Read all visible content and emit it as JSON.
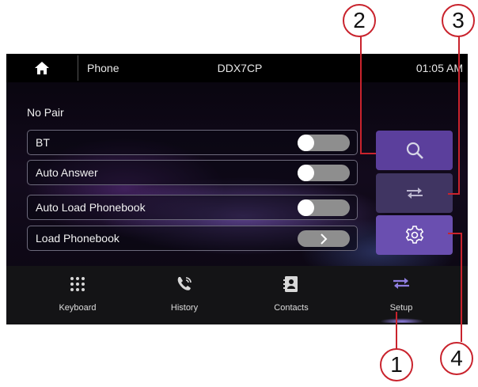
{
  "topbar": {
    "home_icon": "home-icon",
    "title": "Phone",
    "device": "DDX7CP",
    "time": "01:05 AM"
  },
  "status": "No Pair",
  "settings": [
    {
      "label": "BT",
      "control": "toggle"
    },
    {
      "label": "Auto Answer",
      "control": "toggle"
    },
    {
      "label": "Auto Load Phonebook",
      "control": "toggle"
    },
    {
      "label": "Load Phonebook",
      "control": "arrow"
    }
  ],
  "side_buttons": [
    {
      "icon": "search-icon"
    },
    {
      "icon": "swap-icon"
    },
    {
      "icon": "gear-icon"
    }
  ],
  "nav": [
    {
      "label": "Keyboard",
      "icon": "keypad-icon"
    },
    {
      "label": "History",
      "icon": "phone-history-icon"
    },
    {
      "label": "Contacts",
      "icon": "contacts-icon"
    },
    {
      "label": "Setup",
      "icon": "swap-icon"
    }
  ],
  "callouts": [
    "1",
    "2",
    "3",
    "4"
  ],
  "colors": {
    "accent": "#6a4fb0",
    "accent_dim": "#4a3d78",
    "callout": "#c9232d"
  }
}
